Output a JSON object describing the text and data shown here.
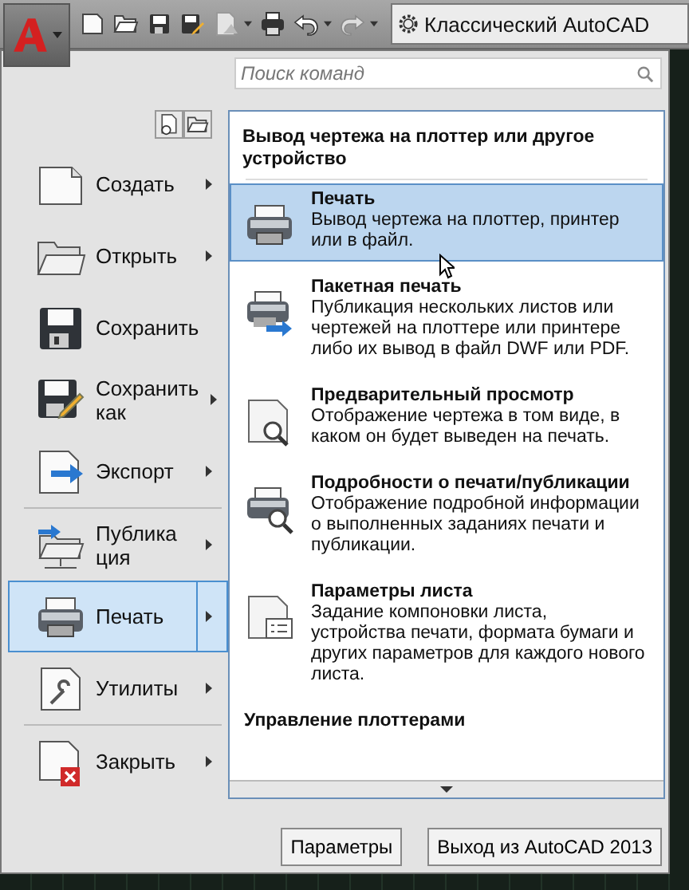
{
  "toolbar": {
    "workspace": "Классический AutoCAD"
  },
  "search": {
    "placeholder": "Поиск команд"
  },
  "menu_items": [
    {
      "kind": "new",
      "label": "Создать",
      "has_submenu": true,
      "selected": false,
      "divider_after": false
    },
    {
      "kind": "open",
      "label": "Открыть",
      "has_submenu": true,
      "selected": false,
      "divider_after": false
    },
    {
      "kind": "save",
      "label": "Сохранить",
      "has_submenu": false,
      "selected": false,
      "divider_after": false
    },
    {
      "kind": "saveas",
      "label": "Сохранить как",
      "has_submenu": true,
      "selected": false,
      "divider_after": false
    },
    {
      "kind": "export",
      "label": "Экспорт",
      "has_submenu": true,
      "selected": false,
      "divider_after": true
    },
    {
      "kind": "publish",
      "label": "Публикация",
      "has_submenu": true,
      "selected": false,
      "divider_after": false
    },
    {
      "kind": "print",
      "label": "Печать",
      "has_submenu": true,
      "selected": true,
      "divider_after": false
    },
    {
      "kind": "utilities",
      "label": "Утилиты",
      "has_submenu": true,
      "selected": false,
      "divider_after": true
    },
    {
      "kind": "close",
      "label": "Закрыть",
      "has_submenu": true,
      "selected": false,
      "divider_after": false
    }
  ],
  "submenu": {
    "header": "Вывод чертежа на плоттер или другое устройство",
    "items": [
      {
        "kind": "print",
        "title": "Печать",
        "description": "Вывод чертежа на плоттер, принтер или в файл.",
        "selected": true
      },
      {
        "kind": "batch",
        "title": "Пакетная печать",
        "description": "Публикация нескольких листов или чертежей на плоттере или принтере либо их вывод в файл DWF или PDF.",
        "selected": false
      },
      {
        "kind": "preview",
        "title": "Предварительный просмотр",
        "description": "Отображение чертежа в том виде, в каком он будет выведен на печать.",
        "selected": false
      },
      {
        "kind": "details",
        "title": "Подробности о печати/публикации",
        "description": "Отображение подробной информации о выполненных заданиях печати и публикации.",
        "selected": false
      },
      {
        "kind": "pagesetup",
        "title": "Параметры листа",
        "description": "Задание компоновки листа, устройства печати, формата бумаги и других параметров для каждого нового листа.",
        "selected": false
      },
      {
        "kind": "plotters",
        "title": "Управление плоттерами",
        "selected": false
      }
    ]
  },
  "buttons": [
    "Параметры",
    "Выход из AutoCAD 2013"
  ]
}
